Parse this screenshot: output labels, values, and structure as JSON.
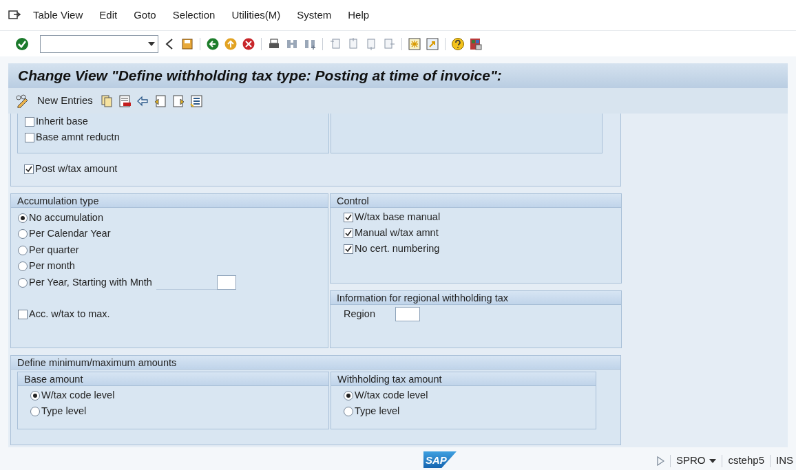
{
  "menu": [
    {
      "label": "Table View"
    },
    {
      "label": "Edit"
    },
    {
      "label": "Goto"
    },
    {
      "label": "Selection"
    },
    {
      "label": "Utilities(M)"
    },
    {
      "label": "System"
    },
    {
      "label": "Help"
    }
  ],
  "title": "Change View \"Define withholding tax type: Posting at time of invoice\":",
  "app_toolbar": {
    "new_entries": "New Entries"
  },
  "posting": {
    "checkboxes": [
      {
        "label": "Inherit base",
        "checked": false
      },
      {
        "label": "Base amnt reductn",
        "checked": false
      }
    ],
    "post_wtax": {
      "label": "Post w/tax amount",
      "checked": true
    }
  },
  "accumulation": {
    "title": "Accumulation type",
    "options": [
      {
        "label": "No accumulation",
        "selected": true,
        "kind": "plain"
      },
      {
        "label": "Per Calendar Year",
        "selected": false,
        "kind": "plain"
      },
      {
        "label": "Per quarter",
        "selected": false,
        "kind": "plain"
      },
      {
        "label": "Per month",
        "selected": false,
        "kind": "plain"
      },
      {
        "label": "Per Year, Starting with Mnth",
        "selected": false,
        "kind": "with_field"
      }
    ],
    "acc_to_max": {
      "label": "Acc. w/tax to max.",
      "checked": false
    }
  },
  "control": {
    "title": "Control",
    "checkboxes": [
      {
        "label": "W/tax base manual",
        "checked": true
      },
      {
        "label": "Manual w/tax amnt",
        "checked": true
      },
      {
        "label": "No cert. numbering",
        "checked": true
      }
    ]
  },
  "regional": {
    "title": "Information for regional withholding tax",
    "region_label": "Region"
  },
  "minmax": {
    "title": "Define minimum/maximum amounts",
    "groups": [
      {
        "title": "Base amount",
        "options": [
          {
            "label": "W/tax code level",
            "selected": true
          },
          {
            "label": "Type level",
            "selected": false
          }
        ]
      },
      {
        "title": "Withholding tax amount",
        "options": [
          {
            "label": "W/tax code level",
            "selected": true
          },
          {
            "label": "Type level",
            "selected": false
          }
        ]
      }
    ]
  },
  "status_bar": {
    "logo": "SAP",
    "transaction": "SPRO",
    "server": "cstehp5",
    "mode": "INS"
  }
}
